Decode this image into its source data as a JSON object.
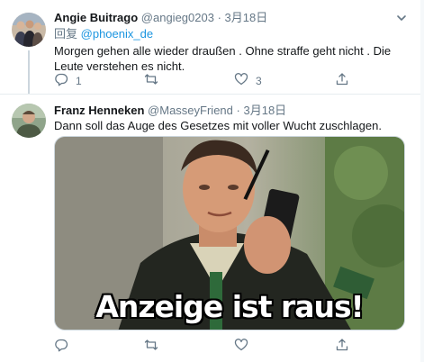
{
  "tweets": [
    {
      "name": "Angie Buitrago",
      "handle": "@angieg0203",
      "separator": "·",
      "date": "3月18日",
      "reply_prefix": "回复",
      "reply_to": "@phoenix_de",
      "text": "Morgen gehen alle wieder draußen . Ohne straffe geht nicht . Die Leute verstehen es nicht.",
      "replies": "1",
      "likes": "3"
    },
    {
      "name": "Franz Henneken",
      "handle": "@MasseyFriend",
      "separator": "·",
      "date": "3月18日",
      "text": "Dann soll das Auge des Gesetzes mit voller Wucht zuschlagen.",
      "media_caption": "Anzeige ist raus!"
    }
  ],
  "icons": {
    "caret": "chevron-down-icon",
    "reply": "reply-icon",
    "retweet": "retweet-icon",
    "like": "heart-icon",
    "share": "share-icon"
  },
  "colors": {
    "text": "#14171a",
    "secondary": "#657786",
    "link": "#1b95e0",
    "divider": "#e6ecf0"
  }
}
